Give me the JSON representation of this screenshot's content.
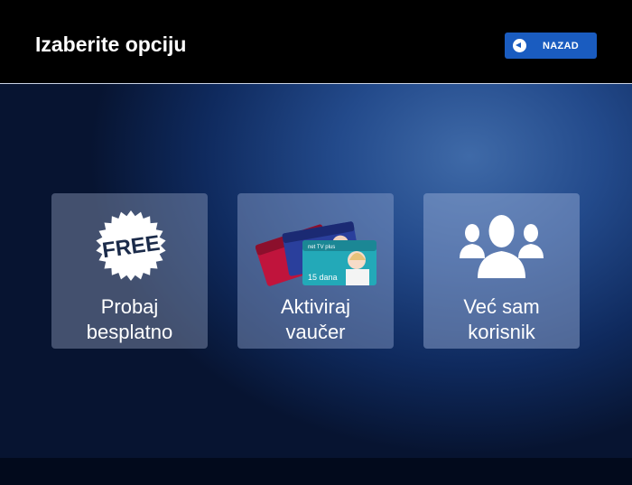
{
  "header": {
    "title": "Izaberite opciju",
    "back_button": {
      "label": "NAZAD",
      "icon": "back-arrow-icon"
    }
  },
  "options": [
    {
      "id": "free",
      "label": "Probaj\nbesplatno",
      "icon": "free-badge-icon",
      "badge_text": "FREE"
    },
    {
      "id": "voucher",
      "label": "Aktiviraj\nvaučer",
      "icon": "voucher-cards-icon",
      "card_text": "15 dana"
    },
    {
      "id": "existing",
      "label": "Već sam\nkorisnik",
      "icon": "users-icon"
    }
  ],
  "colors": {
    "header_bg": "#000000",
    "accent": "#1a5cc0",
    "background": "#234a8b"
  }
}
